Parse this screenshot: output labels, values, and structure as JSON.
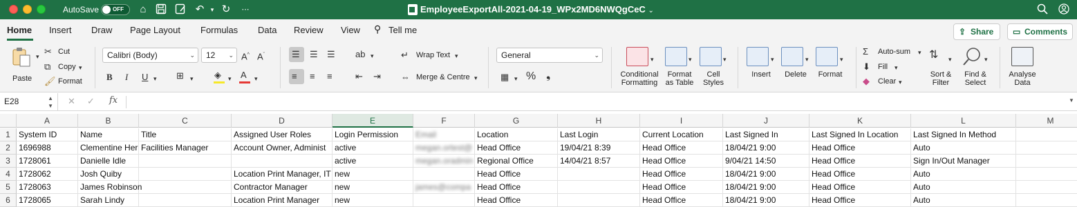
{
  "titlebar": {
    "autosave_label": "AutoSave",
    "autosave_state": "OFF",
    "document_title": "EmployeeExportAll-2021-04-19_WPx2MD6NWQgCeC",
    "title_chevron": "⌄",
    "bg_color": "#1f7145"
  },
  "tabs": [
    "Home",
    "Insert",
    "Draw",
    "Page Layout",
    "Formulas",
    "Data",
    "Review",
    "View",
    "Tell me"
  ],
  "share_label": "Share",
  "comments_label": "Comments",
  "ribbon": {
    "paste": "Paste",
    "cut": "Cut",
    "copy": "Copy",
    "format": "Format",
    "font_name": "Calibri (Body)",
    "font_size": "12",
    "bold": "B",
    "italic": "I",
    "underline": "U",
    "wrap_text": "Wrap Text",
    "merge_centre": "Merge & Centre",
    "number_format": "General",
    "percent": "%",
    "comma": "❟",
    "conditional_formatting_1": "Conditional",
    "conditional_formatting_2": "Formatting",
    "format_as_table_1": "Format",
    "format_as_table_2": "as Table",
    "cell_styles_1": "Cell",
    "cell_styles_2": "Styles",
    "insert": "Insert",
    "delete": "Delete",
    "format_cells": "Format",
    "autosum": "Auto-sum",
    "fill": "Fill",
    "clear": "Clear",
    "sort_filter_1": "Sort &",
    "sort_filter_2": "Filter",
    "find_select_1": "Find &",
    "find_select_2": "Select",
    "analyse_1": "Analyse",
    "analyse_2": "Data"
  },
  "formula_bar": {
    "name_box": "E28",
    "fx": "fx",
    "value": ""
  },
  "columns": [
    "A",
    "B",
    "C",
    "D",
    "E",
    "F",
    "G",
    "H",
    "I",
    "J",
    "K",
    "L",
    "M"
  ],
  "rows": [
    [
      "System ID",
      "Name",
      "Title",
      "Assigned User Roles",
      "Login Permission",
      "Email",
      "Location",
      "Last Login",
      "Current Location",
      "Last Signed In",
      "Last Signed In Location",
      "Last Signed In Method",
      ""
    ],
    [
      "1696988",
      "Clementine Her",
      "Facilities Manager",
      "Account Owner, Administ",
      "active",
      "megan.ortest@",
      "Head Office",
      "19/04/21 8:39",
      "Head Office",
      "18/04/21 9:00",
      "Head Office",
      "Auto",
      ""
    ],
    [
      "1728061",
      "Danielle Idle",
      "",
      "",
      "active",
      "megan.oradmin",
      "Regional Office",
      "14/04/21 8:57",
      "Head Office",
      "9/04/21 14:50",
      "Head Office",
      "Sign In/Out Manager",
      ""
    ],
    [
      "1728062",
      "Josh Quiby",
      "",
      "Location Print Manager, IT",
      "new",
      "",
      "Head Office",
      "",
      "Head Office",
      "18/04/21 9:00",
      "Head Office",
      "Auto",
      ""
    ],
    [
      "1728063",
      "James Robinson",
      "",
      "Contractor Manager",
      "new",
      "james@compa",
      "Head Office",
      "",
      "Head Office",
      "18/04/21 9:00",
      "Head Office",
      "Auto",
      ""
    ],
    [
      "1728065",
      "Sarah Lindy",
      "",
      "Location Print Manager",
      "new",
      "",
      "Head Office",
      "",
      "Head Office",
      "18/04/21 9:00",
      "Head Office",
      "Auto",
      ""
    ]
  ],
  "row_numbers": [
    "1",
    "2",
    "3",
    "4",
    "5",
    "6"
  ]
}
